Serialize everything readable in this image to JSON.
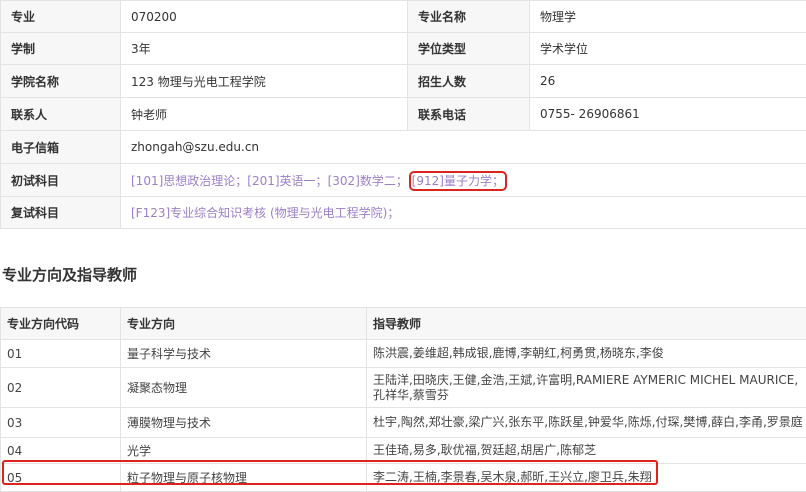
{
  "info": {
    "major_label": "专业",
    "major_value": "070200",
    "major_name_label": "专业名称",
    "major_name_value": "物理学",
    "duration_label": "学制",
    "duration_value": "3年",
    "degree_type_label": "学位类型",
    "degree_type_value": "学术学位",
    "college_label": "学院名称",
    "college_value": "123 物理与光电工程学院",
    "enroll_label": "招生人数",
    "enroll_value": "26",
    "contact_label": "联系人",
    "contact_value": "钟老师",
    "phone_label": "联系电话",
    "phone_value": "0755- 26906861",
    "email_label": "电子信箱",
    "email_value": "zhongah@szu.edu.cn",
    "initial_exam_label": "初试科目",
    "initial_subjects": [
      "[101]思想政治理论；",
      "[201]英语一；",
      "[302]数学二；",
      "[912]量子力学；"
    ],
    "retest_label": "复试科目",
    "retest_subject": "[F123]专业综合知识考核 (物理与光电工程学院)；"
  },
  "section_title": "专业方向及指导教师",
  "directions": {
    "headers": [
      "专业方向代码",
      "专业方向",
      "指导教师"
    ],
    "rows": [
      {
        "code": "01",
        "name": "量子科学与技术",
        "advisors": "陈洪震,姜维超,韩成银,鹿博,李朝红,柯勇贯,杨晓东,李俊"
      },
      {
        "code": "02",
        "name": "凝聚态物理",
        "advisors": "王陆洋,田晓庆,王健,金浩,王斌,许富明,RAMIERE AYMERIC MICHEL MAURICE,孔祥华,蔡雪芬"
      },
      {
        "code": "03",
        "name": "薄膜物理与技术",
        "advisors": "杜宇,陶然,郑壮豪,梁广兴,张东平,陈跃星,钟爱华,陈烁,付琛,樊博,薛白,李甬,罗景庭"
      },
      {
        "code": "04",
        "name": "光学",
        "advisors": "王佳琦,易多,耿优福,贺廷超,胡居广,陈郁芝"
      },
      {
        "code": "05",
        "name": "粒子物理与原子核物理",
        "advisors": "李二涛,王楠,李景春,吴木泉,郝昕,王兴立,廖卫兵,朱翔"
      }
    ]
  }
}
